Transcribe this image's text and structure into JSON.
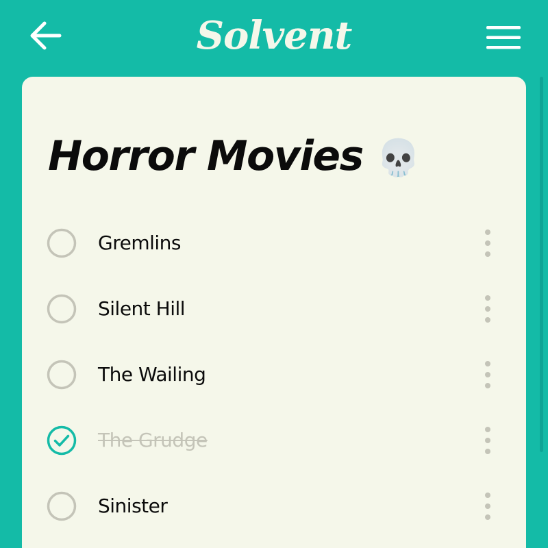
{
  "app": {
    "logo_text": "Solvent",
    "colors": {
      "brand": "#14bba7",
      "card": "#f5f7ea",
      "text": "#0b0b0b",
      "muted": "#c4c4b8",
      "check_accent": "#14bba7"
    }
  },
  "header": {
    "back_icon": "arrow-left-icon",
    "menu_icon": "hamburger-menu-icon"
  },
  "list": {
    "title": "Horror Movies",
    "title_emoji": "💀",
    "items": [
      {
        "label": "Gremlins",
        "done": false
      },
      {
        "label": "Silent Hill",
        "done": false
      },
      {
        "label": "The Wailing",
        "done": false
      },
      {
        "label": "The Grudge",
        "done": true
      },
      {
        "label": "Sinister",
        "done": false
      }
    ]
  }
}
